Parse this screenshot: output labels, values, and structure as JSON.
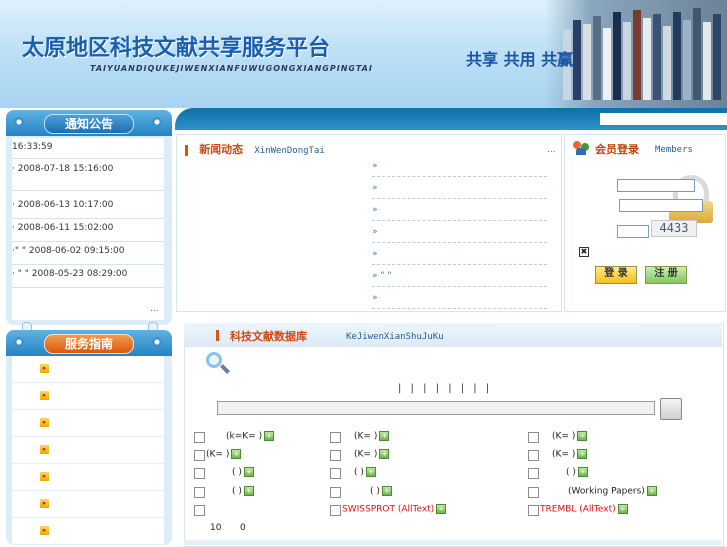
{
  "header": {
    "site_title": "太原地区科技文献共享服务平台",
    "site_pinyin": "TAIYUANDIQUKEJIWENXIANFUWUGONGXIANGPINGTAI",
    "slogan": "共享 共用 共赢"
  },
  "notice": {
    "title": "通知公告",
    "items": [
      {
        "text": "16:33:59"
      },
      {
        "text": "· 2008-07-18 15:16:00"
      },
      {
        "text": "· 2008-06-13 10:17:00"
      },
      {
        "text": "· 2008-06-11 15:02:00"
      },
      {
        "text": "·\" \" 2008-06-02 09:15:00"
      },
      {
        "text": "· \" \" 2008-05-23 08:29:00"
      }
    ],
    "more": "..."
  },
  "guide": {
    "title": "服务指南",
    "items": [
      "",
      "",
      "",
      "",
      "",
      "",
      ""
    ]
  },
  "news": {
    "title": "新闻动态",
    "pinyin": "XinWenDongTai",
    "more": "...",
    "items": [
      "»",
      "»",
      "»",
      "»",
      "»",
      "» \" \"",
      "»"
    ]
  },
  "member": {
    "title": "会员登录",
    "pinyin": "Members",
    "captcha": "4433",
    "login_label": "登 录",
    "register_label": "注 册"
  },
  "database": {
    "title": "科技文献数据库",
    "pinyin": "KeJiwenXianShuJuKu",
    "search_hint": "| | | | | | | |",
    "rows": [
      [
        "(k=K= )",
        "(K= )",
        "(K= )"
      ],
      [
        "(K= )",
        "(K= )",
        "(K= )"
      ],
      [
        "( )",
        "( )",
        "( )"
      ],
      [
        "( )",
        "( )",
        "(Working Papers)"
      ],
      [
        "",
        "SWISSPROT (AllText)",
        "TREMBL (AllText)"
      ]
    ],
    "footer_a": "10",
    "footer_b": "0"
  },
  "colors": {
    "accent": "#1f78b8",
    "title_red": "#d2470f",
    "link_red": "#e01010"
  }
}
